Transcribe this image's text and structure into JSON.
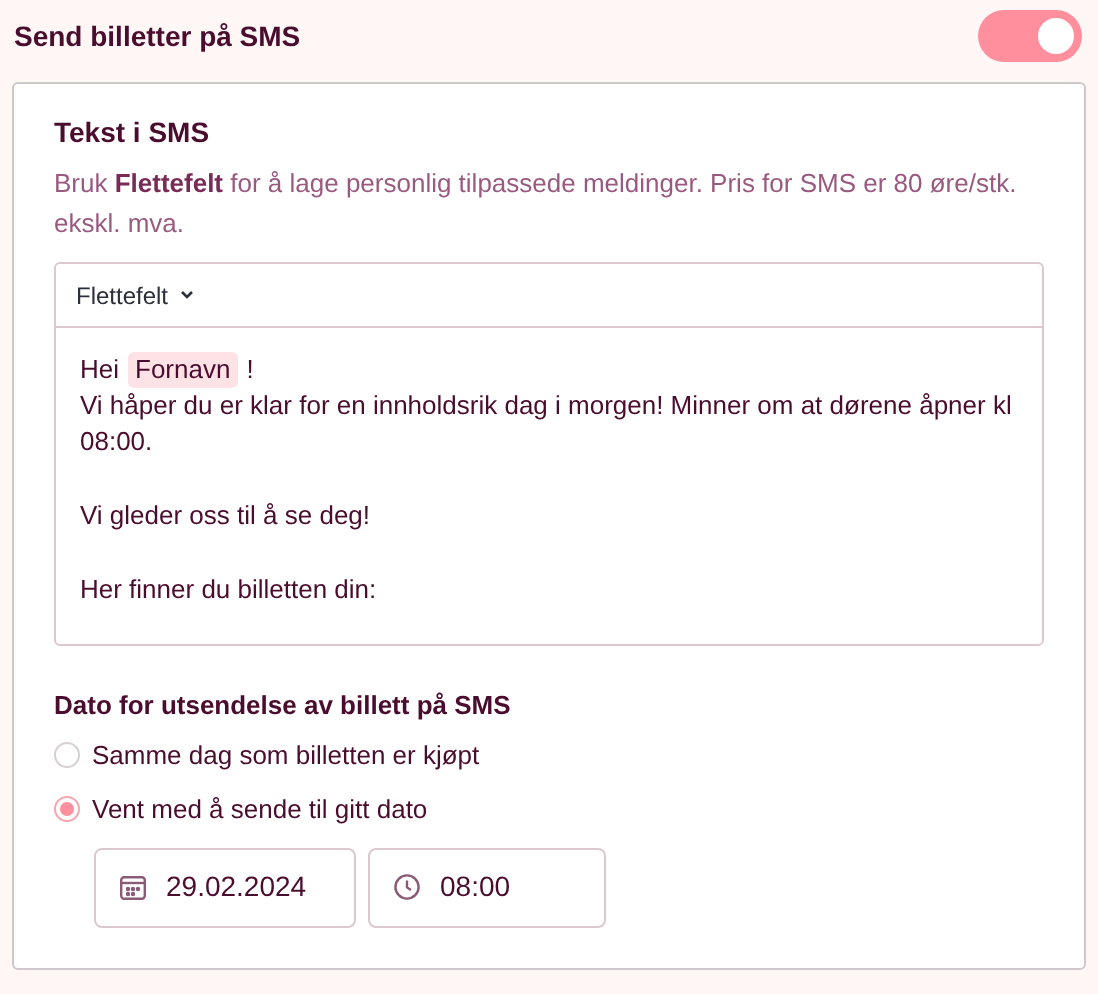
{
  "header": {
    "title": "Send billetter på SMS",
    "toggle_on": true
  },
  "sms_text": {
    "title": "Tekst i SMS",
    "description": "Bruk **Flettefelt** for å lage personlig tilpassede meldinger. Pris for SMS er 80 øre/stk. ekskl. mva.",
    "editor": {
      "toolbar_label": "Flettefelt",
      "paragraphs": [
        [
          [
            {
              "kind": "text",
              "text": "Hei"
            },
            {
              "kind": "field",
              "text": "Fornavn"
            },
            {
              "kind": "text",
              "text": "!"
            }
          ],
          [
            {
              "kind": "text",
              "text": "Vi håper du er klar for en innholdsrik dag i morgen! Minner om at dørene åpner kl 08:00."
            }
          ]
        ],
        [
          [
            {
              "kind": "text",
              "text": "Vi gleder oss til å se deg!"
            }
          ]
        ],
        [
          [
            {
              "kind": "text",
              "text": "Her finner du billetten din:"
            }
          ]
        ]
      ]
    }
  },
  "send_date": {
    "title": "Dato for utsendelse av billett på SMS",
    "options": [
      {
        "label": "Samme dag som billetten er kjøpt",
        "selected": false
      },
      {
        "label": "Vent med å sende til gitt dato",
        "selected": true
      }
    ],
    "date": "29.02.2024",
    "time": "08:00"
  }
}
